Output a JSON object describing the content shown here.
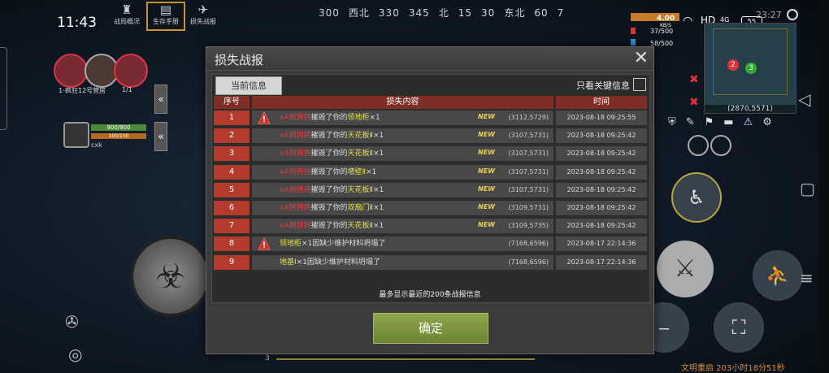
{
  "status": {
    "time": "11:43",
    "clock2": "23:27",
    "speed": "4.00",
    "speed_unit": "KB/S",
    "wifi": "HD",
    "signal": "4G",
    "battery": "55"
  },
  "compass": [
    "300",
    "西北",
    "330",
    "345",
    "北",
    "15",
    "30",
    "东北",
    "60",
    "7"
  ],
  "top_tabs": [
    {
      "label": "战局概况"
    },
    {
      "label": "生存手册"
    },
    {
      "label": "损失战报"
    }
  ],
  "top_tabs_icons": [
    "tower-icon",
    "book-icon",
    "plane-icon"
  ],
  "resources": {
    "a": "37/500",
    "b": "58/500"
  },
  "minimap": {
    "coord": "(2870,5571)",
    "dot1": "2",
    "dot2": "3"
  },
  "player": {
    "hp": "900/900",
    "food": "100/100",
    "name": "cxk",
    "team_text": "1-疯狂12号营房",
    "group": "1/1"
  },
  "dialog": {
    "title": "损失战报",
    "tab_current": "当前信息",
    "filter_label": "只看关键信息",
    "headers": {
      "idx": "序号",
      "content": "损失内容",
      "time": "时间"
    },
    "rows": [
      {
        "idx": "1",
        "attacker": "xA佣佣佣",
        "verb": "摧毁了你的",
        "item": "领地柜",
        "qty": "×1",
        "tag": "NEW",
        "coord": "(3112,5729)",
        "time": "2023-08-18 09:25:55",
        "warn": true
      },
      {
        "idx": "2",
        "attacker": "xA佣佣佣",
        "verb": "摧毁了你的",
        "item": "天花板Ⅱ",
        "qty": "×1",
        "tag": "NEW",
        "coord": "(3107,5731)",
        "time": "2023-08-18 09:25:42",
        "warn": false
      },
      {
        "idx": "3",
        "attacker": "xA佣佣佣",
        "verb": "摧毁了你的",
        "item": "天花板Ⅱ",
        "qty": "×1",
        "tag": "NEW",
        "coord": "(3107,5731)",
        "time": "2023-08-18 09:25:42",
        "warn": false
      },
      {
        "idx": "4",
        "attacker": "xA佣佣佣",
        "verb": "摧毁了你的",
        "item": "墙壁Ⅱ",
        "qty": "×1",
        "tag": "NEW",
        "coord": "(3107,5731)",
        "time": "2023-08-18 09:25:42",
        "warn": false
      },
      {
        "idx": "5",
        "attacker": "xA佣佣佣",
        "verb": "摧毁了你的",
        "item": "天花板Ⅱ",
        "qty": "×1",
        "tag": "NEW",
        "coord": "(3107,5731)",
        "time": "2023-08-18 09:25:42",
        "warn": false
      },
      {
        "idx": "6",
        "attacker": "xA佣佣佣",
        "verb": "摧毁了你的",
        "item": "双扇门Ⅱ",
        "qty": "×1",
        "tag": "NEW",
        "coord": "(3109,5731)",
        "time": "2023-08-18 09:25:42",
        "warn": false
      },
      {
        "idx": "7",
        "attacker": "xA佣佣佣",
        "verb": "摧毁了你的",
        "item": "天花板Ⅱ",
        "qty": "×1",
        "tag": "NEW",
        "coord": "(3109,5735)",
        "time": "2023-08-18 09:25:42",
        "warn": false
      },
      {
        "idx": "8",
        "attacker": "",
        "verb": "",
        "item": "领地柜",
        "qty": "×1因缺少维护材料坍塌了",
        "tag": "",
        "coord": "(7168,6596)",
        "time": "2023-08-17 22:14:36",
        "warn": true
      },
      {
        "idx": "9",
        "attacker": "",
        "verb": "",
        "item": "地基Ⅰ",
        "qty": "×1因缺少维护材料坍塌了",
        "tag": "",
        "coord": "(7168,6596)",
        "time": "2023-08-17 22:14:36",
        "warn": false
      }
    ],
    "footnote": "最多显示最近的200条战报信息",
    "confirm": "确定"
  },
  "bottom_right": "文明重启 203小时18分51秒",
  "hotbar_page": "3",
  "colors": {
    "header_red": "#7e2e24",
    "index_red": "#b33b2b",
    "attacker": "#e23b3b",
    "item": "#e7e14a",
    "confirm": "#7d963e"
  }
}
